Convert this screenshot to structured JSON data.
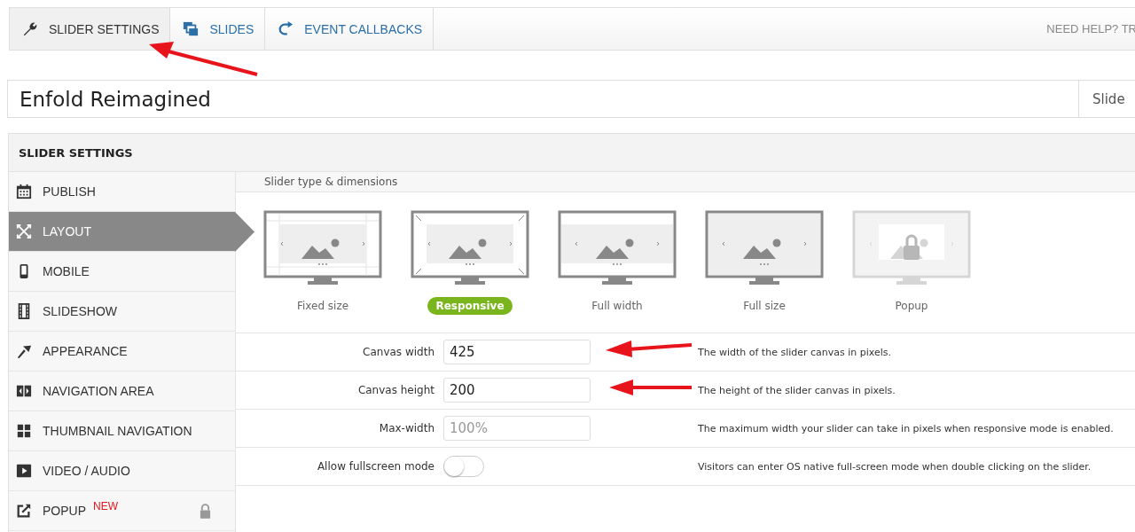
{
  "tabs": [
    {
      "label": "SLIDER SETTINGS",
      "kind": "wrench",
      "selected": true
    },
    {
      "label": "SLIDES",
      "kind": "slides",
      "selected": false
    },
    {
      "label": "EVENT CALLBACKS",
      "kind": "redo",
      "selected": false
    }
  ],
  "help_link": "NEED HELP? TR",
  "slider_title": "Enfold Reimagined",
  "title_side_label": "Slide",
  "panel_title": "SLIDER SETTINGS",
  "sidebar": {
    "items": [
      {
        "label": "PUBLISH",
        "kind": "calendar",
        "selected": false
      },
      {
        "label": "LAYOUT",
        "kind": "expand",
        "selected": true
      },
      {
        "label": "MOBILE",
        "kind": "phone",
        "selected": false
      },
      {
        "label": "SLIDESHOW",
        "kind": "film",
        "selected": false
      },
      {
        "label": "APPEARANCE",
        "kind": "brush",
        "selected": false
      },
      {
        "label": "NAVIGATION AREA",
        "kind": "nav",
        "selected": false
      },
      {
        "label": "THUMBNAIL NAVIGATION",
        "kind": "grid",
        "selected": false
      },
      {
        "label": "VIDEO / AUDIO",
        "kind": "play",
        "selected": false
      },
      {
        "label": "POPUP",
        "kind": "external",
        "selected": false,
        "badge": "NEW",
        "locked": true
      }
    ]
  },
  "section_title": "Slider type & dimensions",
  "slider_types": [
    {
      "label": "Fixed size",
      "kind": "fixed",
      "selected": false,
      "disabled": false
    },
    {
      "label": "Responsive",
      "kind": "responsive",
      "selected": true,
      "disabled": false
    },
    {
      "label": "Full width",
      "kind": "fullwidth",
      "selected": false,
      "disabled": false
    },
    {
      "label": "Full size",
      "kind": "fullsize",
      "selected": false,
      "disabled": false
    },
    {
      "label": "Popup",
      "kind": "popup",
      "selected": false,
      "disabled": true
    }
  ],
  "settings": [
    {
      "kind": "input",
      "label": "Canvas width",
      "value": "425",
      "description": "The width of the slider canvas in pixels."
    },
    {
      "kind": "input",
      "label": "Canvas height",
      "value": "200",
      "description": "The height of the slider canvas in pixels."
    },
    {
      "kind": "input",
      "label": "Max-width",
      "placeholder": "100%",
      "description": "The maximum width your slider can take in pixels when responsive mode is enabled."
    },
    {
      "kind": "toggle",
      "label": "Allow fullscreen mode",
      "on": false,
      "description": "Visitors can enter OS native full-screen mode when double clicking on the slider."
    }
  ]
}
